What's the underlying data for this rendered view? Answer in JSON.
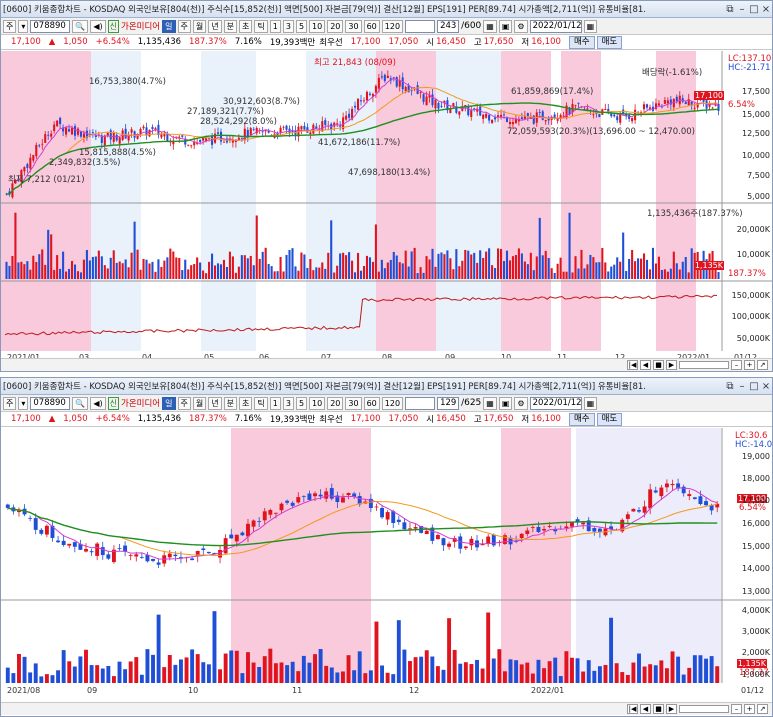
{
  "top": {
    "title": "[0600] 키움종합차트 - KOSDAQ 외국인보유[804(천)] 주식수[15,852(천)] 액면[500] 자본금[79(억)] 결산[12월] EPS[191] PER[89.74] 시가총액[2,711(억)] 유통비율[81.",
    "code": "078890",
    "name": "가온미디어",
    "period_label": "일",
    "periods": [
      "주",
      "월",
      "년",
      "분",
      "초",
      "틱"
    ],
    "intervals": [
      "1",
      "3",
      "5",
      "10",
      "20",
      "30",
      "60",
      "120"
    ],
    "count": "243",
    "count_total": "/600",
    "date": "2022/01/12",
    "price": {
      "last": "17,100",
      "arrow": "▲",
      "change": "1,050",
      "pct": "+6.54%",
      "volume": "1,135,436",
      "vol_ratio": "187.37%",
      "turnover": "7.16%",
      "amount": "19,393백만",
      "best_label": "최우선",
      "best_ask": "17,100",
      "best_bid": "17,050",
      "open_label": "시",
      "open": "16,450",
      "high_label": "고",
      "high": "17,650",
      "low_label": "저",
      "low": "16,100",
      "buy_label": "매수",
      "sell_label": "매도"
    },
    "annotations": {
      "high_note": "최고 21,843 (08/09)",
      "dividend": "배당락(-1.61%)",
      "lc": "LC:137.10",
      "hc": "HC:-21.71",
      "a1": "16,753,380(4.7%)",
      "a2": "30,912,603(8.7%)",
      "a3": "27,189,321(7.7%)",
      "a4": "28,524,292(8.0%)",
      "a5": "15,815,888(4.5%)",
      "a6": "2,349,832(3.5%)",
      "a7": "41,672,186(11.7%)",
      "a8": "61,859,869(17.4%)",
      "a9": "72,059,593(20.3%)(13,696.00 ~ 12,470.00)",
      "a10": "47,698,180(13.4%)",
      "low_note": "최저 7,212 (01/21)",
      "vol_note": "1,135,436주(187.37%)",
      "price_tag": "17,100",
      "price_tag2": "6.54%",
      "vol_tag": "1,135K",
      "vol_tag2": "187.37%"
    },
    "y_price": [
      "17,500",
      "15,000",
      "12,500",
      "10,000",
      "7,500",
      "5,000"
    ],
    "y_vol": [
      "20,000K",
      "10,000K"
    ],
    "y_ind": [
      "150,000K",
      "100,000K",
      "50,000K"
    ],
    "x_labels": [
      "2021/01",
      "03",
      "04",
      "05",
      "06",
      "07",
      "08",
      "09",
      "10",
      "11",
      "12",
      "2022/01",
      "01/12"
    ]
  },
  "bottom": {
    "title": "[0600] 키움종합차트 - KOSDAQ 외국인보유[804(천)] 주식수[15,852(천)] 액면[500] 자본금[79(억)] 결산[12월] EPS[191] PER[89.74] 시가총액[2,711(억)] 유통비율[81.",
    "code": "078890",
    "name": "가온미디어",
    "count": "129",
    "count_total": "/625",
    "date": "2022/01/12",
    "lc": "LC:30.6",
    "hc": "HC:-14.0",
    "y_price": [
      "19,000",
      "18,000",
      "17,000",
      "16,000",
      "15,000",
      "14,000",
      "13,000"
    ],
    "y_vol": [
      "4,000K",
      "3,000K",
      "2,000K",
      "1,000K"
    ],
    "price_tag": "17,100",
    "price_tag2": "6.54%",
    "vol_tag": "1,135K",
    "vol_tag2": "187.37",
    "x_labels": [
      "2021/08",
      "09",
      "10",
      "11",
      "12",
      "2022/01",
      "01/12"
    ]
  },
  "colors": {
    "up": "#e0141e",
    "down": "#1f4fd6",
    "pink_band": "#f9c9dc",
    "blue_band": "#e9f1fb"
  }
}
